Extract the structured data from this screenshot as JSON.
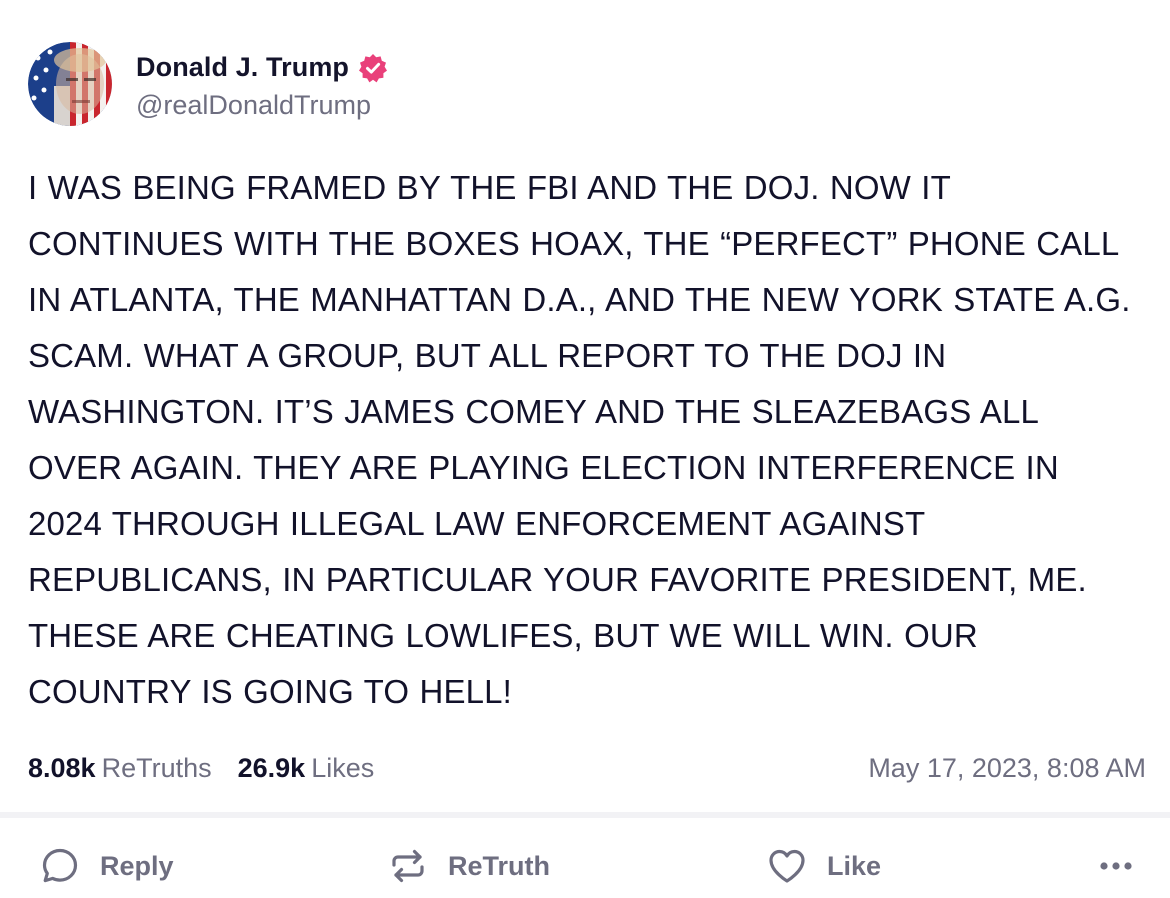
{
  "author": {
    "display_name": "Donald J. Trump",
    "handle": "@realDonaldTrump",
    "verified": true,
    "verified_badge_color": "#e9407a"
  },
  "post": {
    "text": "I WAS BEING FRAMED BY THE FBI AND THE DOJ. NOW IT CONTINUES WITH THE BOXES HOAX, THE “PERFECT” PHONE CALL IN ATLANTA, THE MANHATTAN D.A., AND THE NEW YORK STATE A.G. SCAM. WHAT A GROUP, BUT ALL REPORT TO THE DOJ IN WASHINGTON. IT’S JAMES COMEY AND THE SLEAZEBAGS ALL OVER AGAIN. THEY ARE PLAYING ELECTION INTERFERENCE IN 2024 THROUGH ILLEGAL LAW ENFORCEMENT AGAINST REPUBLICANS, IN PARTICULAR YOUR FAVORITE PRESIDENT, ME. THESE ARE CHEATING LOWLIFES, BUT WE WILL WIN. OUR COUNTRY IS GOING TO HELL!"
  },
  "stats": {
    "retruths_count": "8.08k",
    "retruths_label": "ReTruths",
    "likes_count": "26.9k",
    "likes_label": "Likes",
    "timestamp": "May 17, 2023, 8:08 AM"
  },
  "actions": {
    "reply_label": "Reply",
    "retruth_label": "ReTruth",
    "like_label": "Like",
    "more_icon": "more-horizontal-icon"
  },
  "colors": {
    "text_primary": "#12122a",
    "text_secondary": "#6e6e80",
    "divider": "#f2f2f5"
  }
}
